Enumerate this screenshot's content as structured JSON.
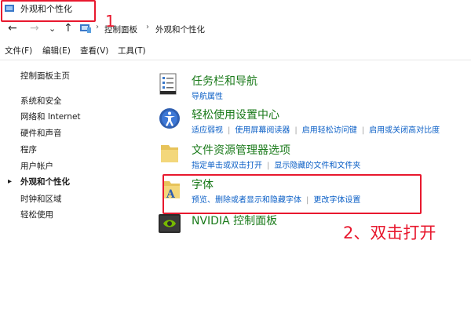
{
  "window": {
    "title": "外观和个性化"
  },
  "nav": {
    "back": "←",
    "forward": "→",
    "history": "⌄",
    "up": "↑",
    "crumbs": [
      "控制面板",
      "外观和个性化"
    ],
    "crumb_sep": "›"
  },
  "menu": [
    "文件(F)",
    "编辑(E)",
    "查看(V)",
    "工具(T)"
  ],
  "sidebar": {
    "items": [
      {
        "label": "控制面板主页"
      },
      {
        "label": "系统和安全"
      },
      {
        "label": "网络和 Internet"
      },
      {
        "label": "硬件和声音"
      },
      {
        "label": "程序"
      },
      {
        "label": "用户帐户"
      },
      {
        "label": "外观和个性化",
        "active": true
      },
      {
        "label": "时钟和区域"
      },
      {
        "label": "轻松使用"
      }
    ]
  },
  "categories": [
    {
      "title": "任务栏和导航",
      "icon": "taskbar-icon",
      "links": [
        "导航属性"
      ]
    },
    {
      "title": "轻松使用设置中心",
      "icon": "ease-of-access-icon",
      "links": [
        "适应弱视",
        "使用屏幕阅读器",
        "启用轻松访问键",
        "启用或关闭高对比度"
      ]
    },
    {
      "title": "文件资源管理器选项",
      "icon": "folder-icon",
      "links": [
        "指定单击或双击打开",
        "显示隐藏的文件和文件夹"
      ]
    },
    {
      "title": "字体",
      "icon": "fonts-folder-icon",
      "links": [
        "预览、删除或者显示和隐藏字体",
        "更改字体设置"
      ]
    },
    {
      "title": "NVIDIA 控制面板",
      "icon": "nvidia-icon",
      "links": []
    }
  ],
  "annotations": {
    "step1": "1",
    "step2": "2、双击打开",
    "color": "#e8182e"
  },
  "colors": {
    "category_title": "#1a7a1a",
    "link": "#0b5fc6"
  }
}
